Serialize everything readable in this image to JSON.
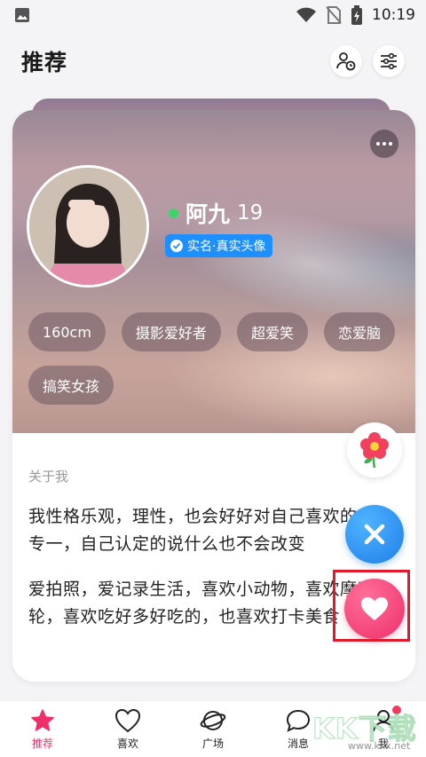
{
  "status_bar": {
    "time": "10:19"
  },
  "header": {
    "title": "推荐"
  },
  "profile": {
    "name": "阿九",
    "age": "19",
    "verify_label": "实名·真实头像",
    "tags": [
      "160cm",
      "摄影爱好者",
      "超爱笑",
      "恋爱脑",
      "搞笑女孩"
    ],
    "about_label": "关于我",
    "about_paragraphs": [
      "我性格乐观，理性，也会好好对自己喜欢的人，专一，自己认定的说什么也不会改变",
      "爱拍照，爱记录生活，喜欢小动物，喜欢摩天轮，喜欢吃好多好吃的，也喜欢打卡美食"
    ]
  },
  "colors": {
    "accent": "#ef2f6a",
    "verify_blue": "#1e8fff",
    "online_green": "#3ed26a"
  },
  "nav": {
    "items": [
      {
        "label": "推荐",
        "icon": "star-icon",
        "active": true
      },
      {
        "label": "喜欢",
        "icon": "heart-outline-icon"
      },
      {
        "label": "广场",
        "icon": "planet-icon"
      },
      {
        "label": "消息",
        "icon": "chat-bubble-icon"
      },
      {
        "label": "我",
        "icon": "person-icon"
      }
    ]
  },
  "watermark": {
    "main": "KK下载",
    "sub": "www.kkx.net"
  }
}
